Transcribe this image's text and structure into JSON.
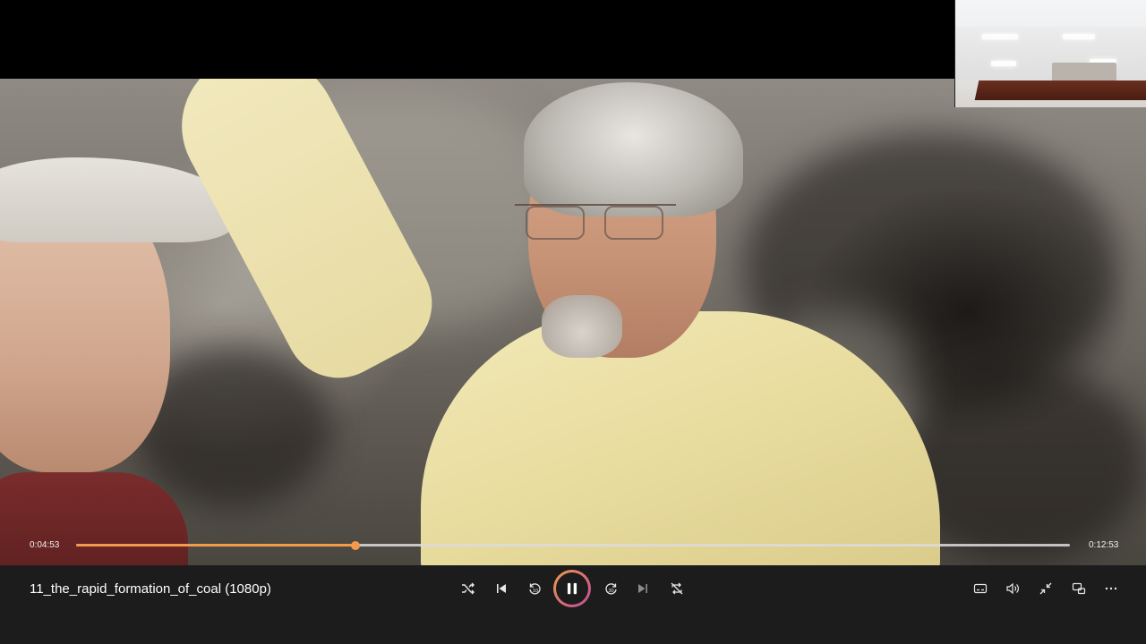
{
  "media": {
    "title": "11_the_rapid_formation_of_coal (1080p)"
  },
  "playback": {
    "current_time": "0:04:53",
    "total_time": "0:12:53",
    "progress_fraction": 0.2808,
    "state": "playing"
  },
  "controls": {
    "shuffle": "shuffle-icon",
    "previous": "previous-track-icon",
    "rewind_10": "rewind-10-icon",
    "play_pause": "pause-icon",
    "forward_30": "forward-30-icon",
    "next": "next-track-icon",
    "repeat": "repeat-off-icon",
    "captions": "captions-icon",
    "volume": "volume-icon",
    "mini_player": "exit-fullscreen-icon",
    "cast": "cast-icon",
    "more": "more-options-icon"
  },
  "colors": {
    "accent": "#f39a4c",
    "accent_gradient_end": "#c04a9a",
    "bar_bg": "#1c1c1c"
  }
}
